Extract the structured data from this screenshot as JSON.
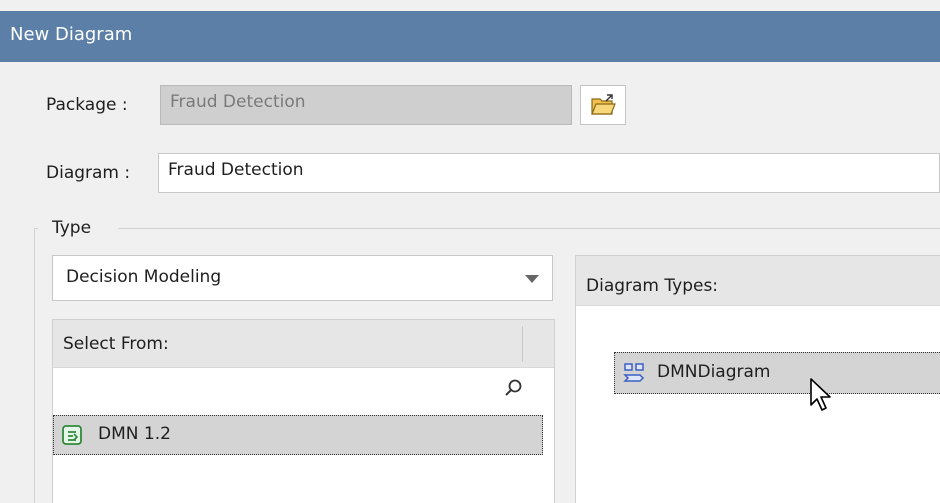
{
  "dialog": {
    "title": "New Diagram"
  },
  "package": {
    "label": "Package :",
    "value": "Fraud Detection"
  },
  "diagram": {
    "label": "Diagram :",
    "value": "Fraud Detection"
  },
  "type_group": {
    "label": "Type",
    "category_select": {
      "selected": "Decision Modeling"
    },
    "select_from": {
      "header": "Select From:",
      "items": [
        {
          "label": "DMN 1.2",
          "icon": "dmn-package-icon"
        }
      ]
    },
    "diagram_types": {
      "header": "Diagram Types:",
      "items": [
        {
          "label": "DMNDiagram",
          "icon": "dmn-diagram-icon"
        }
      ]
    }
  },
  "colors": {
    "title_bar": "#5b7fa6",
    "selection": "#d4d4d4",
    "icon_green": "#2f8a3a",
    "icon_blue": "#3b5fc4"
  }
}
